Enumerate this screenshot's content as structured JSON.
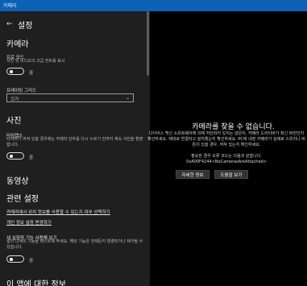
{
  "titlebar": {
    "title": "카메라"
  },
  "settings": {
    "header": "설정",
    "camera_section": "카메라",
    "pro_mode_label": "프로 모드",
    "pro_mode_desc": "사진 및 비디오의 고급 컨트롤 표시",
    "pro_mode_toggle": "끔",
    "grid_label": "프레이밍 그리드",
    "grid_value": "끄기",
    "photo_section": "사진",
    "timelapse_label": "타임랩스",
    "timelapse_desc": "타이머가 켜져 있을 경우에는 카메라 단추를 다시 누르기 전까지 계속 사진을 촬영합니다.",
    "timelapse_toggle": "끔",
    "video_section": "동영상",
    "related_section": "관련 설정",
    "link_location": "카메라에서 위치 정보를 사용할 수 있는지 여부 선택하기",
    "link_privacy": "개인 정보 설정 변경하기",
    "new_exp_label": "새 실험적 기능 사용해 보기",
    "new_exp_desc": "앱이 다계의 기능을 테스트해 주세요. 해당 기능은 언제든지 변경되거나 제거될 수 있습니다.",
    "new_exp_toggle": "끔",
    "about_section": "이 앱에 대한 정보"
  },
  "main": {
    "title": "카메라를 찾을 수 없습니다.",
    "body": "다이어스 백신 소프트웨어에 의해 차단되어 있지는 않은지, 카메라 드라이버가 최신 버전인지 확인하세요. 제대로 연결되고 설치했는지 확인하세요. PC에 내장 카메라가 실제로 스위치나 버튼이 있을 경우, 켜져 있는지 확인하세요.",
    "code_prefix": "필요한 경우 오류 코드는 다음과 같습니다.",
    "code": "0xA00F4244<NoCamerasAreAttached>",
    "details_button": "자세한 정보",
    "help_button": "도움말 보기"
  }
}
